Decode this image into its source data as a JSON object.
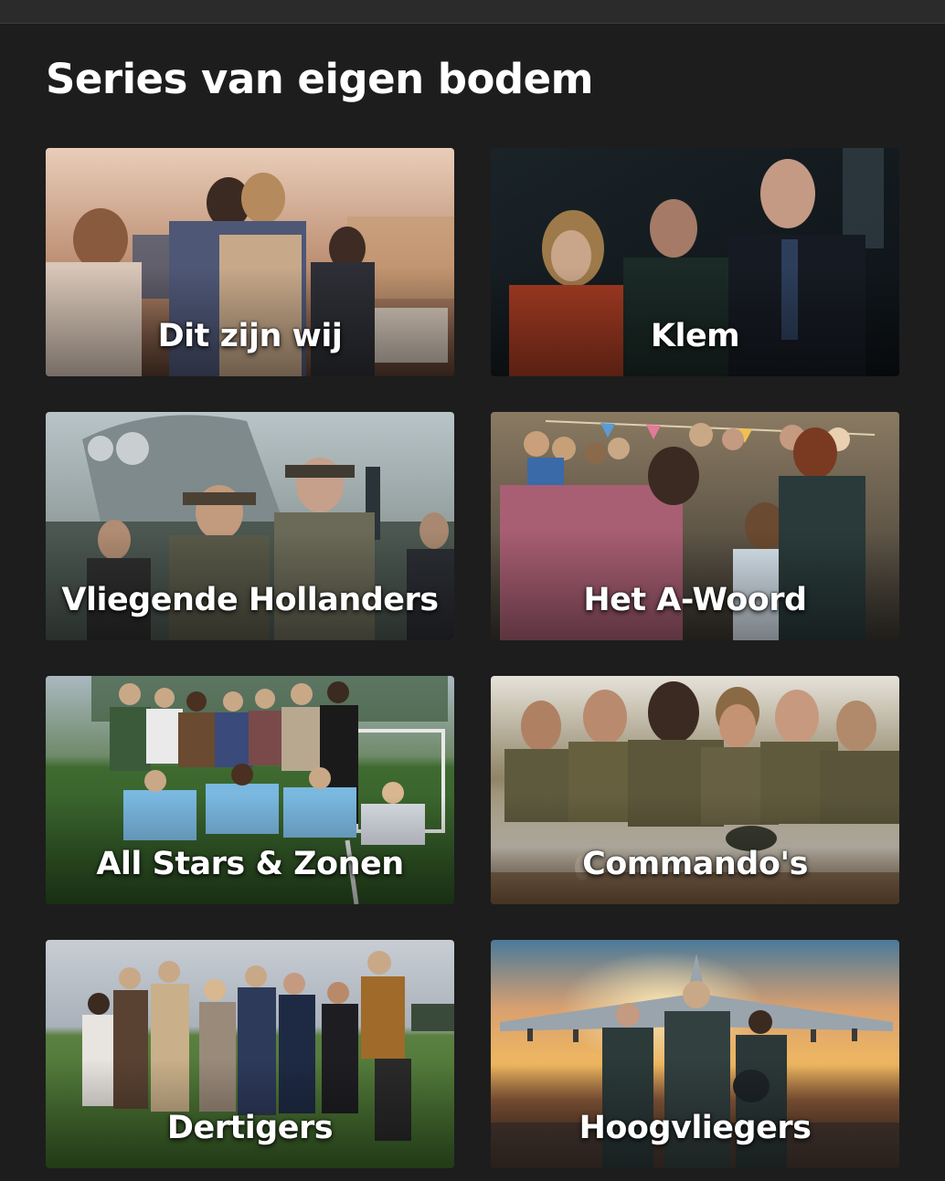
{
  "section": {
    "title": "Series van eigen bodem"
  },
  "tiles": [
    {
      "title": "Dit zijn wij"
    },
    {
      "title": "Klem"
    },
    {
      "title": "Vliegende Hollanders"
    },
    {
      "title": "Het A-Woord"
    },
    {
      "title": "All Stars & Zonen"
    },
    {
      "title": "Commando's"
    },
    {
      "title": "Dertigers"
    },
    {
      "title": "Hoogvliegers"
    }
  ],
  "theme": {
    "background": "#1d1d1d",
    "title_color": "#ffffff"
  }
}
